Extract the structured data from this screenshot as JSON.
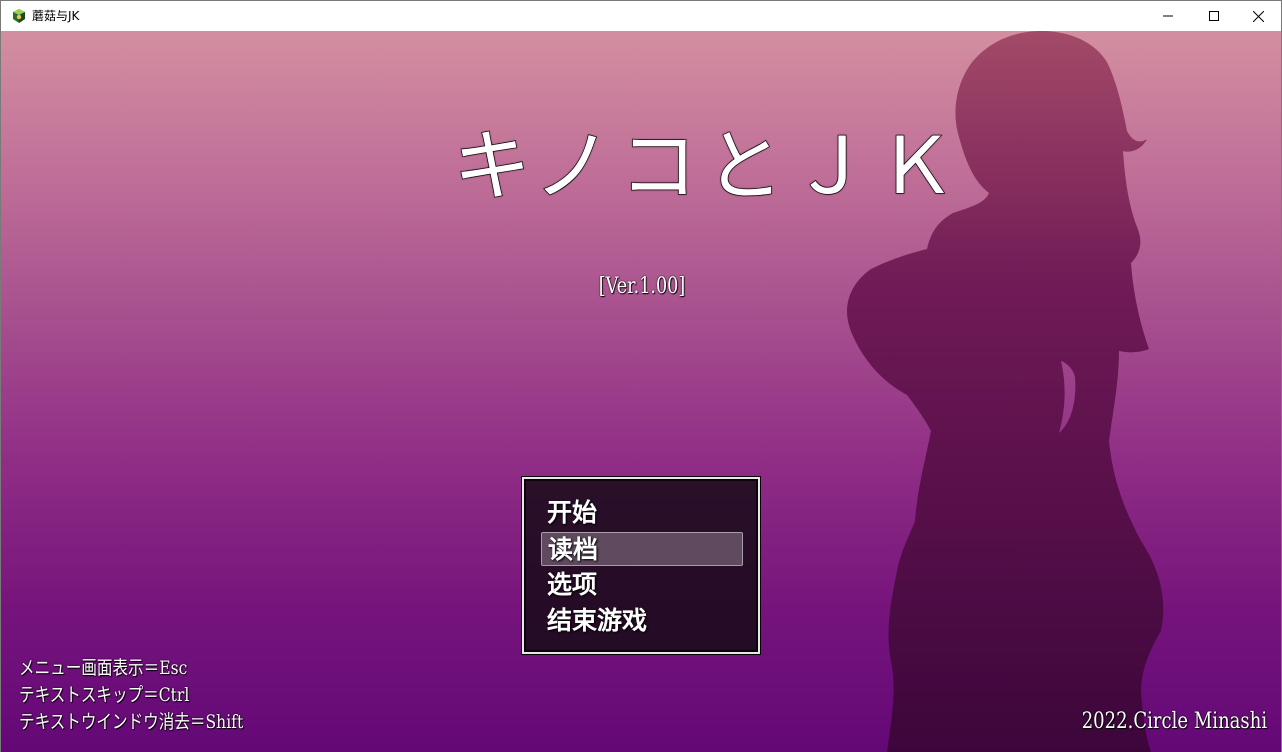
{
  "window": {
    "title": "蘑菇与JK",
    "icon": "app-game-icon"
  },
  "title_screen": {
    "game_title": "キノコとＪＫ",
    "version": "[Ver.1.00]",
    "menu": {
      "items": [
        "开始",
        "读档",
        "选项",
        "结束游戏"
      ],
      "selected_index": 1
    },
    "hints": [
      "メニュー画面表示＝Esc",
      "テキストスキップ＝Ctrl",
      "テキストウインドウ消去＝Shift"
    ],
    "copyright": "2022.Circle Minashi"
  },
  "colors": {
    "background_top": "#d38fa0",
    "background_bottom": "#640877",
    "silhouette": "#3a0638",
    "menu_border": "#e8e8e8"
  }
}
